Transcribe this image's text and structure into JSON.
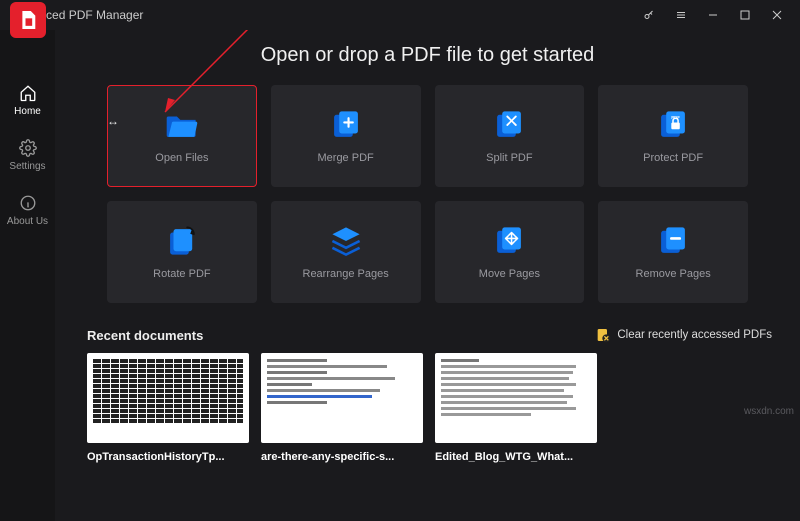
{
  "titlebar": {
    "title": "Advanced PDF Manager"
  },
  "sidebar": {
    "items": [
      {
        "label": "Home"
      },
      {
        "label": "Settings"
      },
      {
        "label": "About Us"
      }
    ]
  },
  "hero": "Open or drop a PDF file to get started",
  "actions": [
    {
      "label": "Open Files"
    },
    {
      "label": "Merge PDF"
    },
    {
      "label": "Split PDF"
    },
    {
      "label": "Protect PDF"
    },
    {
      "label": "Rotate PDF"
    },
    {
      "label": "Rearrange Pages"
    },
    {
      "label": "Move Pages"
    },
    {
      "label": "Remove Pages"
    }
  ],
  "recent": {
    "title": "Recent documents",
    "clear_label": "Clear recently accessed PDFs",
    "items": [
      {
        "name": "OpTransactionHistoryTp..."
      },
      {
        "name": "are-there-any-specific-s..."
      },
      {
        "name": "Edited_Blog_WTG_What..."
      }
    ]
  },
  "watermark": "wsxdn.com"
}
